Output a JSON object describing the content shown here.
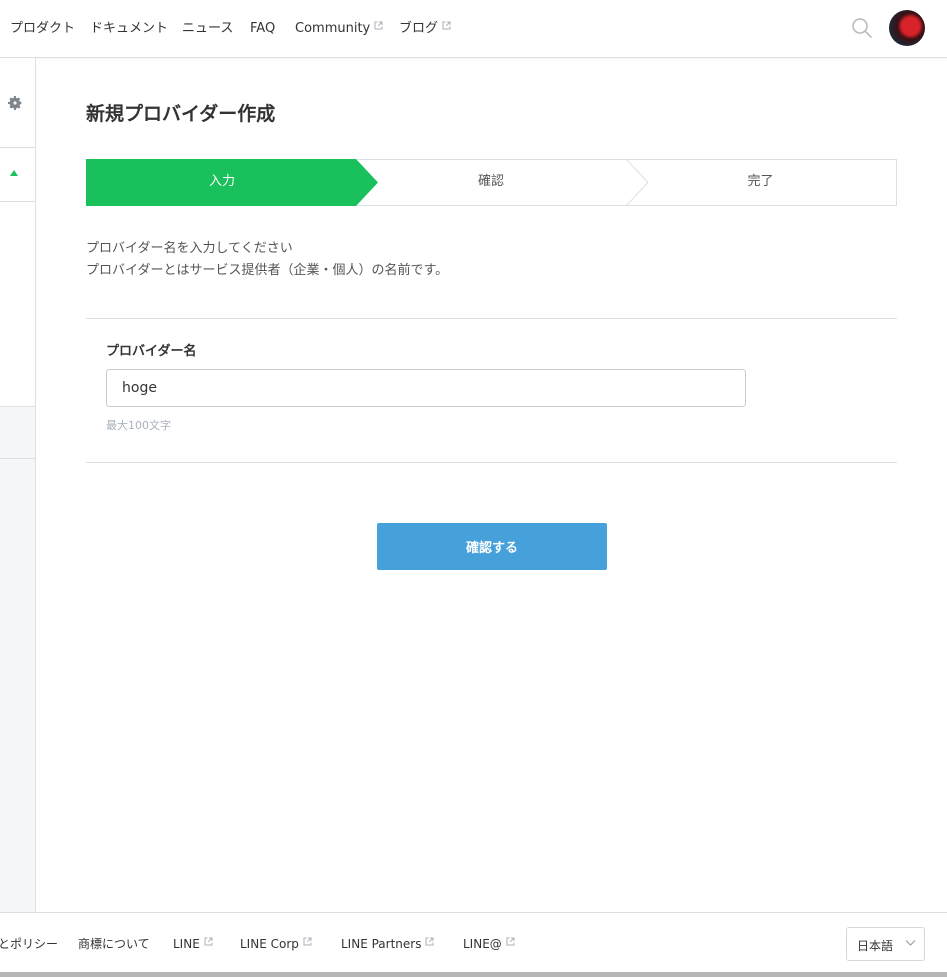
{
  "nav": {
    "items": [
      "プロダクト",
      "ドキュメント",
      "ニュース",
      "FAQ",
      "Community",
      "ブログ"
    ],
    "external": [
      false,
      false,
      false,
      false,
      true,
      true
    ]
  },
  "icons": {
    "search": "search-icon",
    "avatar": "avatar",
    "settings": "gear-icon",
    "collapse": "triangle-up-icon",
    "external": "external-link-icon",
    "dropdown": "chevron-down-icon"
  },
  "main": {
    "title": "新規プロバイダー作成",
    "steps": [
      {
        "label": "入力",
        "active": true
      },
      {
        "label": "確認",
        "active": false
      },
      {
        "label": "完了",
        "active": false
      }
    ],
    "description": [
      "プロバイダー名を入力してください",
      "プロバイダーとはサービス提供者（企業・個人）の名前です。"
    ],
    "form": {
      "label": "プロバイダー名",
      "value": "hoge",
      "hint": "最大100文字"
    },
    "confirm_label": "確認する"
  },
  "footer": {
    "links": [
      "とポリシー",
      "商標について",
      "LINE",
      "LINE Corp",
      "LINE Partners",
      "LINE@"
    ],
    "external": [
      false,
      false,
      true,
      true,
      true,
      true
    ],
    "language": "日本語"
  },
  "colors": {
    "active_step": "#19c05c",
    "primary_button": "#46a0da",
    "border": "#dcdfe3",
    "sidebar_bg": "#f6f7f9",
    "hint_text": "#a9b1bb"
  }
}
